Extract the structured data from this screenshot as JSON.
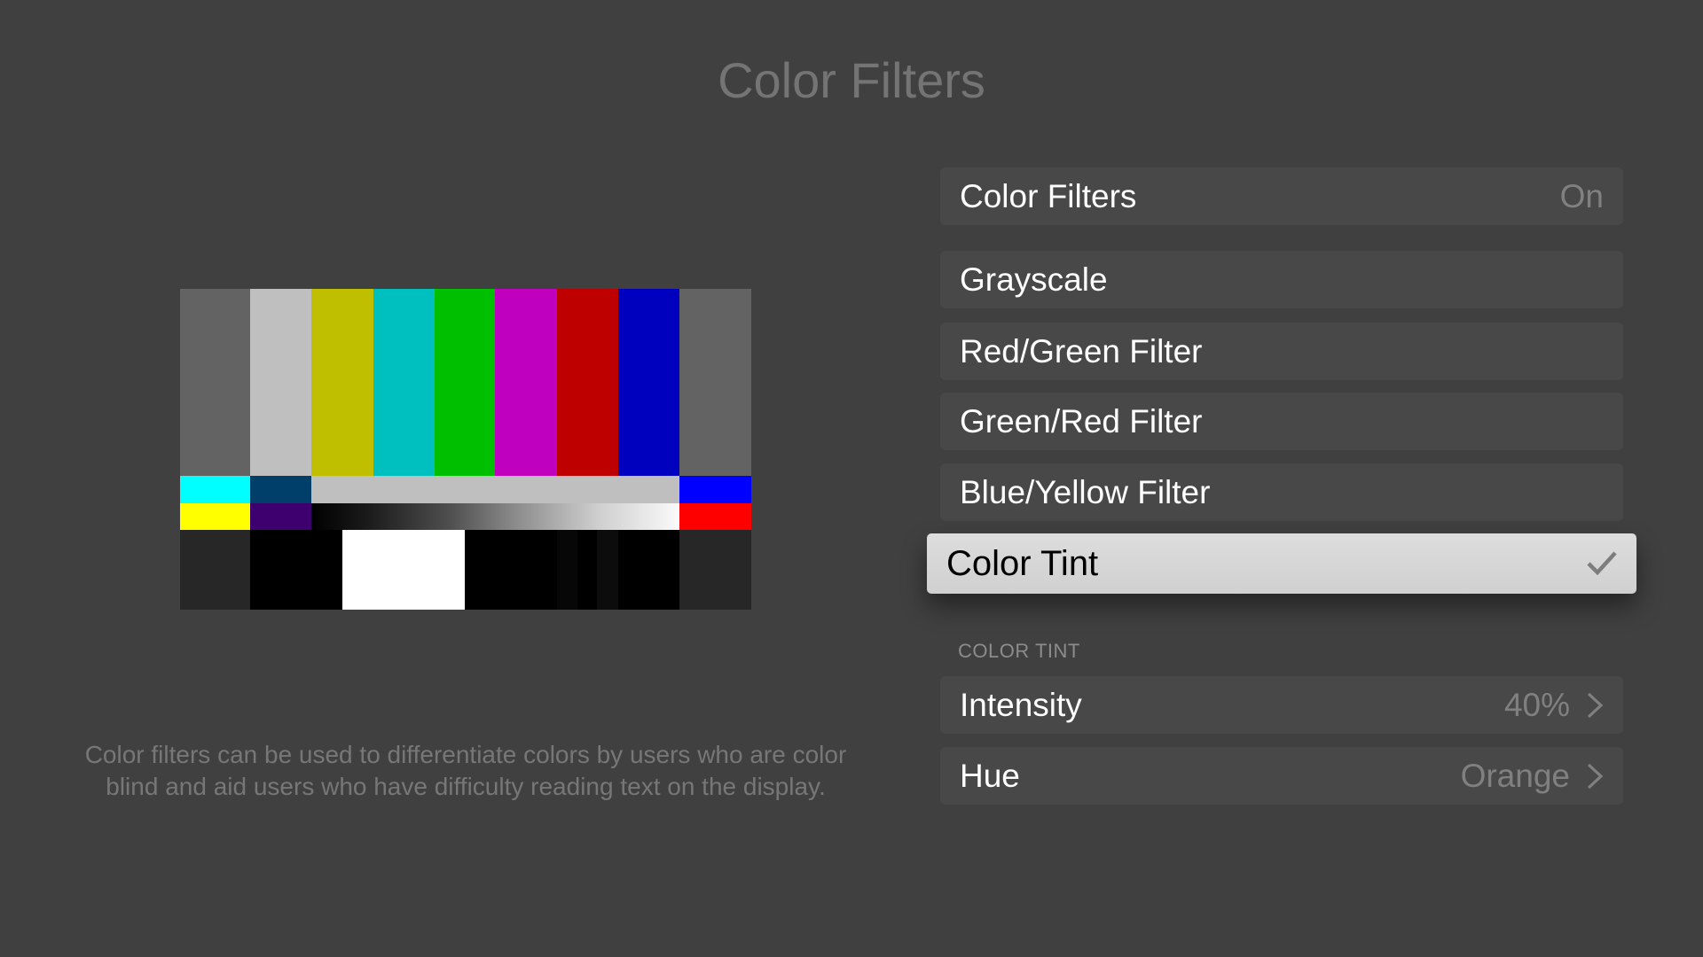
{
  "page": {
    "title": "Color Filters"
  },
  "test_pattern": {
    "top_bars": [
      "#636363",
      "#bfbfbf",
      "#bfbf00",
      "#00bfbf",
      "#00bf00",
      "#bf00bf",
      "#bf0000",
      "#0000bf",
      "#636363"
    ],
    "middle_left": [
      "#00ffff",
      "#003f6a"
    ],
    "middle_center": "#bfbfbf",
    "middle_right": "#0000ff",
    "gradient_left": [
      "#ffff00",
      "#3f006f"
    ],
    "gradient_right": "#ff0000",
    "bottom_colors": [
      "#272727",
      "#000000",
      "#ffffff",
      "#000000",
      "#070707",
      "#000000",
      "#0c0c0c",
      "#000000",
      "#272727"
    ]
  },
  "description": "Color filters can be used to differentiate colors by users who are color blind and aid users who have difficulty reading text on the display.",
  "settings": {
    "master": {
      "label": "Color Filters",
      "value": "On"
    },
    "filters": [
      {
        "label": "Grayscale",
        "selected": false
      },
      {
        "label": "Red/Green Filter",
        "selected": false
      },
      {
        "label": "Green/Red Filter",
        "selected": false
      },
      {
        "label": "Blue/Yellow Filter",
        "selected": false
      },
      {
        "label": "Color Tint",
        "selected": true,
        "icon": "checkmark-icon"
      }
    ],
    "color_tint": {
      "header": "COLOR TINT",
      "items": [
        {
          "label": "Intensity",
          "value": "40%",
          "icon": "chevron-right-icon"
        },
        {
          "label": "Hue",
          "value": "Orange",
          "icon": "chevron-right-icon"
        }
      ]
    }
  }
}
